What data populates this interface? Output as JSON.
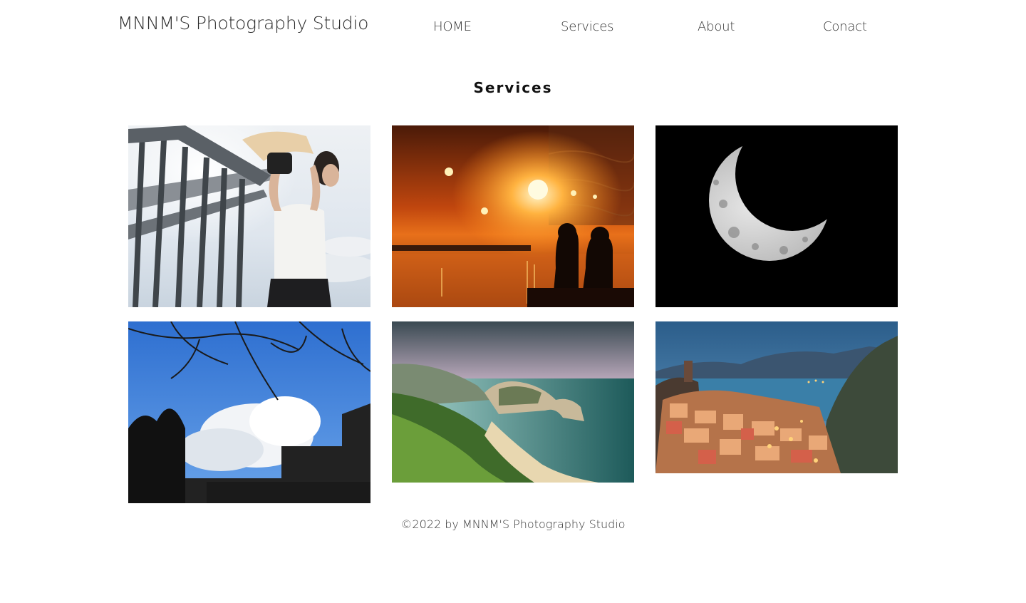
{
  "header": {
    "site_title": "MNNM'S Photography Studio",
    "nav": [
      "HOME",
      "Services",
      "About",
      "Conact"
    ]
  },
  "main": {
    "section_title": "Services",
    "gallery": [
      {
        "subject": "woman-on-stairs-photo"
      },
      {
        "subject": "night-fountain-photo"
      },
      {
        "subject": "crescent-moon-photo"
      },
      {
        "subject": "tree-branches-sky-photo"
      },
      {
        "subject": "coastal-arch-photo"
      },
      {
        "subject": "coastal-village-photo"
      }
    ]
  },
  "footer": {
    "text": "©2022 by MNNM'S Photography Studio"
  },
  "colors": {
    "text": "#333333",
    "background": "#ffffff"
  }
}
